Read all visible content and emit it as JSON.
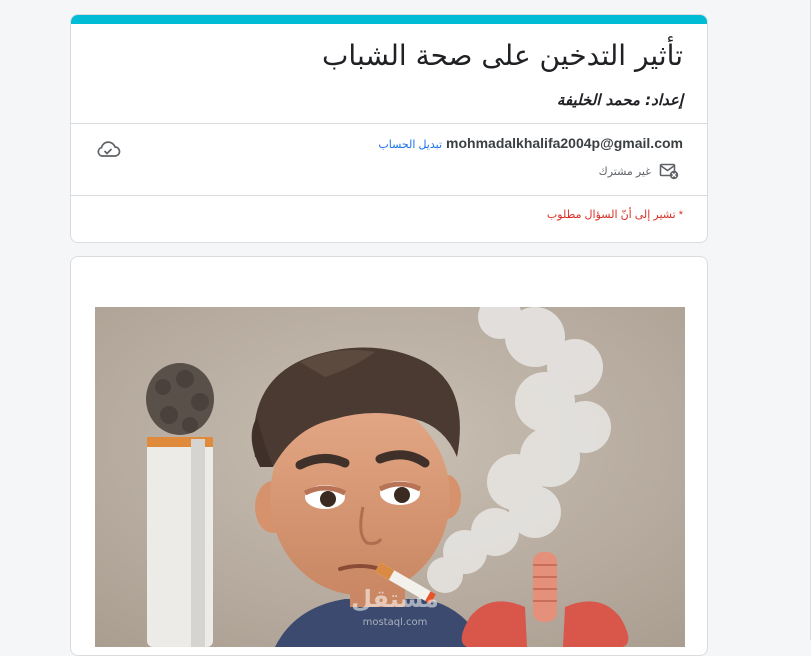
{
  "form": {
    "title": "تأثير التدخين على صحة الشباب",
    "author_line": "إعداد: محمد الخليفة",
    "accent_color": "#00bcd4"
  },
  "account": {
    "email": "mohmadalkhalifa2004p@gmail.com",
    "switch_label": "تبديل الحساب",
    "shared_status": "غير مشترك",
    "shared_icon": "mail-shared-icon",
    "save_icon": "cloud-check-icon"
  },
  "required_note": "* تشير إلى أنّ السؤال مطلوب",
  "image": {
    "watermark_main": "مستقل",
    "watermark_sub": "mostaql.com",
    "icon": "smoking-youth-illustration"
  },
  "colors": {
    "required": "#d93025",
    "link": "#1a73e8"
  }
}
